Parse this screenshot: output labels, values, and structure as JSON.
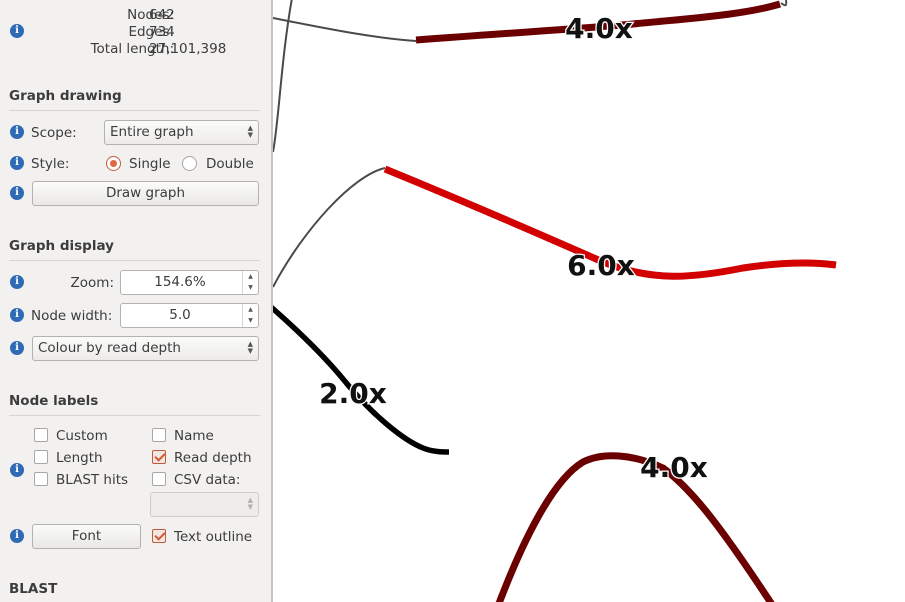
{
  "stats": {
    "nodes_label": "Nodes:",
    "nodes_value": "642",
    "edges_label": "Edges:",
    "edges_value": "734",
    "length_label": "Total length:",
    "length_value": "27,101,398"
  },
  "graph_drawing": {
    "title": "Graph drawing",
    "scope_label": "Scope:",
    "scope_value": "Entire graph",
    "style_label": "Style:",
    "style_options": [
      "Single",
      "Double"
    ],
    "style_selected": "Single",
    "draw_button": "Draw graph"
  },
  "graph_display": {
    "title": "Graph display",
    "zoom_label": "Zoom:",
    "zoom_value": "154.6%",
    "node_width_label": "Node width:",
    "node_width_value": "5.0",
    "colour_mode": "Colour by read depth"
  },
  "node_labels": {
    "title": "Node labels",
    "options": [
      {
        "label": "Custom",
        "checked": false
      },
      {
        "label": "Name",
        "checked": false
      },
      {
        "label": "Length",
        "checked": false
      },
      {
        "label": "Read depth",
        "checked": true
      },
      {
        "label": "BLAST hits",
        "checked": false
      },
      {
        "label": "CSV data:",
        "checked": false
      }
    ],
    "csv_value": "",
    "font_button": "Font",
    "text_outline_label": "Text outline",
    "text_outline_checked": true
  },
  "blast": {
    "title": "BLAST"
  },
  "graph": {
    "nodes": [
      {
        "label": "4.0x",
        "depth": 4.0,
        "color": "#6b0000"
      },
      {
        "label": "6.0x",
        "depth": 6.0,
        "color": "#d20000"
      },
      {
        "label": "2.0x",
        "depth": 2.0,
        "color": "#000000"
      },
      {
        "label": "4.0x",
        "depth": 4.0,
        "color": "#6b0000"
      }
    ],
    "edge_color": "#4a4a4a"
  },
  "colors": {
    "info_icon": "#2f6ab4",
    "accent": "#e0663f",
    "sidebar_bg": "#f2f1f0"
  }
}
